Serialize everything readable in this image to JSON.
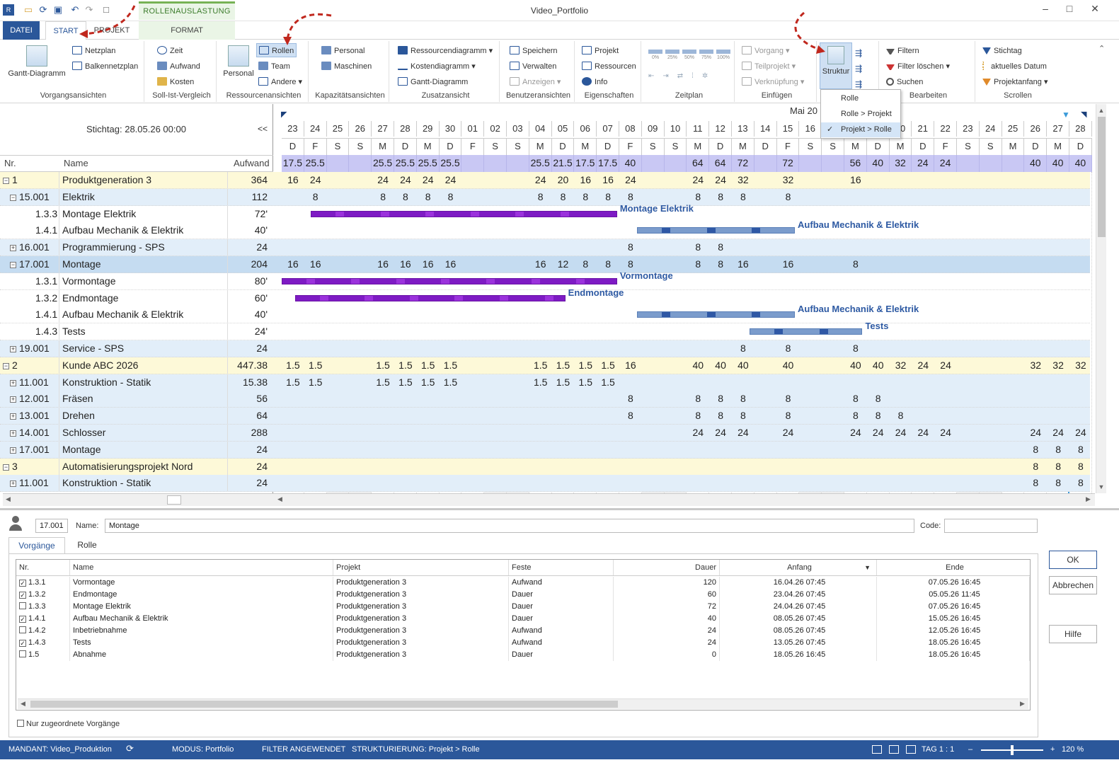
{
  "window": {
    "title": "Video_Portfolio",
    "context_tab": "ROLLENAUSLASTUNG"
  },
  "tabs": [
    "DATEI",
    "START",
    "PROJEKT",
    "FORMAT"
  ],
  "ribbon": {
    "vorgangsansichten": {
      "label": "Vorgangsansichten",
      "gantt": "Gantt-Diagramm",
      "netzplan": "Netzplan",
      "balkennetzplan": "Balkennetzplan"
    },
    "sollist": {
      "label": "Soll-Ist-Vergleich",
      "zeit": "Zeit",
      "aufwand": "Aufwand",
      "kosten": "Kosten"
    },
    "ressourcen": {
      "label": "Ressourcenansichten",
      "personal": "Personal",
      "rollen": "Rollen",
      "team": "Team",
      "andere": "Andere"
    },
    "kapazitaet": {
      "label": "Kapazitätsansichten",
      "personal": "Personal",
      "maschinen": "Maschinen"
    },
    "zusatz": {
      "label": "Zusatzansicht",
      "ressourcendiagramm": "Ressourcendiagramm",
      "kostendiagramm": "Kostendiagramm",
      "gantt": "Gantt-Diagramm"
    },
    "benutzer": {
      "label": "Benutzeransichten",
      "speichern": "Speichern",
      "verwalten": "Verwalten",
      "anzeigen": "Anzeigen"
    },
    "eigenschaften": {
      "label": "Eigenschaften",
      "projekt": "Projekt",
      "ressourcen": "Ressourcen",
      "info": "Info"
    },
    "zeitplan": {
      "label": "Zeitplan",
      "pct": [
        "0%",
        "25%",
        "50%",
        "75%",
        "100%"
      ]
    },
    "einfuegen": {
      "label": "Einfügen",
      "vorgang": "Vorgang",
      "teilprojekt": "Teilprojekt",
      "verknuepfung": "Verknüpfung"
    },
    "struktur": {
      "label": "Struktur"
    },
    "bearbeiten": {
      "label": "Bearbeiten",
      "filtern": "Filtern",
      "filter_loeschen": "Filter löschen",
      "suchen": "Suchen"
    },
    "scrollen": {
      "label": "Scrollen",
      "stichtag": "Stichtag",
      "aktuelles_datum": "aktuelles Datum",
      "projektanfang": "Projektanfang"
    }
  },
  "struktur_menu": {
    "items": [
      "Rolle",
      "Rolle > Projekt",
      "Projekt > Rolle"
    ],
    "checked": "Projekt > Rolle"
  },
  "grid": {
    "stichtag": "Stichtag: 28.05.26 00:00",
    "collapse": "<<",
    "headers": {
      "nr": "Nr.",
      "name": "Name",
      "aufwand": "Aufwand"
    },
    "month": "Mai 20",
    "days": [
      "23",
      "24",
      "25",
      "26",
      "27",
      "28",
      "29",
      "30",
      "01",
      "02",
      "03",
      "04",
      "05",
      "06",
      "07",
      "08",
      "09",
      "10",
      "11",
      "12",
      "13",
      "14",
      "15",
      "16",
      "17",
      "18",
      "19",
      "20",
      "21",
      "22",
      "23",
      "24",
      "25",
      "26",
      "27",
      "28"
    ],
    "weekdays": [
      "D",
      "F",
      "S",
      "S",
      "M",
      "D",
      "M",
      "D",
      "F",
      "S",
      "S",
      "M",
      "D",
      "M",
      "D",
      "F",
      "S",
      "S",
      "M",
      "D",
      "M",
      "D",
      "F",
      "S",
      "S",
      "M",
      "D",
      "M",
      "D",
      "F",
      "S",
      "S",
      "M",
      "D",
      "M",
      "D"
    ],
    "totals": [
      "17.5",
      "25.5",
      "",
      "",
      "25.5",
      "25.5",
      "25.5",
      "25.5",
      "",
      "",
      "",
      "25.5",
      "21.5",
      "17.5",
      "17.5",
      "40",
      "",
      "",
      "64",
      "64",
      "72",
      "",
      "72",
      "",
      "",
      "56",
      "40",
      "32",
      "24",
      "24",
      "",
      "",
      "",
      "40",
      "40",
      "40"
    ],
    "rows": [
      {
        "nr": "1",
        "name": "Produktgeneration 3",
        "aufwand": "364",
        "exp": "−",
        "level": 0,
        "type": "proj",
        "vals": [
          "16",
          "24",
          "",
          "",
          "24",
          "24",
          "24",
          "24",
          "",
          "",
          "",
          "24",
          "20",
          "16",
          "16",
          "24",
          "",
          "",
          "24",
          "24",
          "32",
          "",
          "32",
          "",
          "",
          "16",
          "",
          "",
          "",
          "",
          "",
          "",
          "",
          "",
          "",
          ""
        ]
      },
      {
        "nr": "15.001",
        "name": "Elektrik",
        "aufwand": "112",
        "exp": "−",
        "level": 1,
        "type": "role",
        "vals": [
          "",
          "8",
          "",
          "",
          "8",
          "8",
          "8",
          "8",
          "",
          "",
          "",
          "8",
          "8",
          "8",
          "8",
          "8",
          "",
          "",
          "8",
          "8",
          "8",
          "",
          "8",
          "",
          "",
          "",
          "",
          "",
          "",
          "",
          "",
          "",
          "",
          "",
          "",
          ""
        ]
      },
      {
        "nr": "1.3.3",
        "name": "Montage Elektrik",
        "aufwand": "72'",
        "level": 2,
        "type": "task",
        "vals": []
      },
      {
        "nr": "1.4.1",
        "name": "Aufbau Mechanik & Elektrik",
        "aufwand": "40'",
        "level": 2,
        "type": "task",
        "vals": []
      },
      {
        "nr": "16.001",
        "name": "Programmierung - SPS",
        "aufwand": "24",
        "exp": "+",
        "level": 1,
        "type": "role",
        "vals": [
          "",
          "",
          "",
          "",
          "",
          "",
          "",
          "",
          "",
          "",
          "",
          "",
          "",
          "",
          "",
          "8",
          "",
          "",
          "8",
          "8",
          "",
          "",
          "",
          "",
          "",
          "",
          "",
          "",
          "",
          "",
          "",
          "",
          "",
          "",
          "",
          ""
        ]
      },
      {
        "nr": "17.001",
        "name": "Montage",
        "aufwand": "204",
        "exp": "−",
        "level": 1,
        "type": "rolesel",
        "vals": [
          "16",
          "16",
          "",
          "",
          "16",
          "16",
          "16",
          "16",
          "",
          "",
          "",
          "16",
          "12",
          "8",
          "8",
          "8",
          "",
          "",
          "8",
          "8",
          "16",
          "",
          "16",
          "",
          "",
          "8",
          "",
          "",
          "",
          "",
          "",
          "",
          "",
          "",
          "",
          ""
        ]
      },
      {
        "nr": "1.3.1",
        "name": "Vormontage",
        "aufwand": "80'",
        "level": 2,
        "type": "task",
        "vals": []
      },
      {
        "nr": "1.3.2",
        "name": "Endmontage",
        "aufwand": "60'",
        "level": 2,
        "type": "task",
        "vals": []
      },
      {
        "nr": "1.4.1",
        "name": "Aufbau Mechanik & Elektrik",
        "aufwand": "40'",
        "level": 2,
        "type": "task",
        "vals": []
      },
      {
        "nr": "1.4.3",
        "name": "Tests",
        "aufwand": "24'",
        "level": 2,
        "type": "task",
        "vals": []
      },
      {
        "nr": "19.001",
        "name": "Service - SPS",
        "aufwand": "24",
        "exp": "+",
        "level": 1,
        "type": "role",
        "vals": [
          "",
          "",
          "",
          "",
          "",
          "",
          "",
          "",
          "",
          "",
          "",
          "",
          "",
          "",
          "",
          "",
          "",
          "",
          "",
          "",
          "8",
          "",
          "8",
          "",
          "",
          "8",
          "",
          "",
          "",
          "",
          "",
          "",
          "",
          "",
          "",
          ""
        ]
      },
      {
        "nr": "2",
        "name": "Kunde ABC 2026",
        "aufwand": "447.38",
        "exp": "−",
        "level": 0,
        "type": "proj",
        "vals": [
          "1.5",
          "1.5",
          "",
          "",
          "1.5",
          "1.5",
          "1.5",
          "1.5",
          "",
          "",
          "",
          "1.5",
          "1.5",
          "1.5",
          "1.5",
          "16",
          "",
          "",
          "40",
          "40",
          "40",
          "",
          "40",
          "",
          "",
          "40",
          "40",
          "32",
          "24",
          "24",
          "",
          "",
          "",
          "32",
          "32",
          "32"
        ]
      },
      {
        "nr": "11.001",
        "name": "Konstruktion - Statik",
        "aufwand": "15.38",
        "exp": "+",
        "level": 1,
        "type": "role",
        "vals": [
          "1.5",
          "1.5",
          "",
          "",
          "1.5",
          "1.5",
          "1.5",
          "1.5",
          "",
          "",
          "",
          "1.5",
          "1.5",
          "1.5",
          "1.5",
          "",
          "",
          "",
          "",
          "",
          "",
          "",
          "",
          "",
          "",
          "",
          "",
          "",
          "",
          "",
          "",
          "",
          "",
          "",
          "",
          ""
        ]
      },
      {
        "nr": "12.001",
        "name": "Fräsen",
        "aufwand": "56",
        "exp": "+",
        "level": 1,
        "type": "role",
        "vals": [
          "",
          "",
          "",
          "",
          "",
          "",
          "",
          "",
          "",
          "",
          "",
          "",
          "",
          "",
          "",
          "8",
          "",
          "",
          "8",
          "8",
          "8",
          "",
          "8",
          "",
          "",
          "8",
          "8",
          "",
          "",
          "",
          "",
          "",
          "",
          "",
          "",
          ""
        ]
      },
      {
        "nr": "13.001",
        "name": "Drehen",
        "aufwand": "64",
        "exp": "+",
        "level": 1,
        "type": "role",
        "vals": [
          "",
          "",
          "",
          "",
          "",
          "",
          "",
          "",
          "",
          "",
          "",
          "",
          "",
          "",
          "",
          "8",
          "",
          "",
          "8",
          "8",
          "8",
          "",
          "8",
          "",
          "",
          "8",
          "8",
          "8",
          "",
          "",
          "",
          "",
          "",
          "",
          "",
          ""
        ]
      },
      {
        "nr": "14.001",
        "name": "Schlosser",
        "aufwand": "288",
        "exp": "+",
        "level": 1,
        "type": "role",
        "vals": [
          "",
          "",
          "",
          "",
          "",
          "",
          "",
          "",
          "",
          "",
          "",
          "",
          "",
          "",
          "",
          "",
          "",
          "",
          "24",
          "24",
          "24",
          "",
          "24",
          "",
          "",
          "24",
          "24",
          "24",
          "24",
          "24",
          "",
          "",
          "",
          "24",
          "24",
          "24"
        ]
      },
      {
        "nr": "17.001",
        "name": "Montage",
        "aufwand": "24",
        "exp": "+",
        "level": 1,
        "type": "role",
        "vals": [
          "",
          "",
          "",
          "",
          "",
          "",
          "",
          "",
          "",
          "",
          "",
          "",
          "",
          "",
          "",
          "",
          "",
          "",
          "",
          "",
          "",
          "",
          "",
          "",
          "",
          "",
          "",
          "",
          "",
          "",
          "",
          "",
          "",
          "8",
          "8",
          "8"
        ]
      },
      {
        "nr": "3",
        "name": "Automatisierungsprojekt Nord",
        "aufwand": "24",
        "exp": "−",
        "level": 0,
        "type": "proj",
        "vals": [
          "",
          "",
          "",
          "",
          "",
          "",
          "",
          "",
          "",
          "",
          "",
          "",
          "",
          "",
          "",
          "",
          "",
          "",
          "",
          "",
          "",
          "",
          "",
          "",
          "",
          "",
          "",
          "",
          "",
          "",
          "",
          "",
          "",
          "8",
          "8",
          "8"
        ]
      },
      {
        "nr": "11.001",
        "name": "Konstruktion - Statik",
        "aufwand": "24",
        "exp": "+",
        "level": 1,
        "type": "role",
        "vals": [
          "",
          "",
          "",
          "",
          "",
          "",
          "",
          "",
          "",
          "",
          "",
          "",
          "",
          "",
          "",
          "",
          "",
          "",
          "",
          "",
          "",
          "",
          "",
          "",
          "",
          "",
          "",
          "",
          "",
          "",
          "",
          "",
          "",
          "8",
          "8",
          "8"
        ]
      }
    ],
    "bars": [
      {
        "label": "Montage Elektrik",
        "row": 2,
        "start": 1.3,
        "end": 14.9,
        "color": "purple"
      },
      {
        "label": "Aufbau Mechanik & Elektrik",
        "row": 3,
        "start": 15.8,
        "end": 22.8,
        "color": "blue"
      },
      {
        "label": "Vormontage",
        "row": 6,
        "start": 0,
        "end": 14.9,
        "color": "purple"
      },
      {
        "label": "Endmontage",
        "row": 7,
        "start": 0.6,
        "end": 12.6,
        "color": "purple"
      },
      {
        "label": "Aufbau Mechanik & Elektrik",
        "row": 8,
        "start": 15.8,
        "end": 22.8,
        "color": "blue"
      },
      {
        "label": "Tests",
        "row": 9,
        "start": 20.8,
        "end": 25.8,
        "color": "blue"
      }
    ]
  },
  "detail": {
    "nr": "17.001",
    "name_label": "Name:",
    "name": "Montage",
    "code_label": "Code:",
    "code": "",
    "tabs": [
      "Vorgänge",
      "Rolle"
    ],
    "columns": [
      "Nr.",
      "Name",
      "Projekt",
      "Feste",
      "Dauer",
      "Anfang",
      "Ende"
    ],
    "rows": [
      {
        "checked": true,
        "nr": "1.3.1",
        "name": "Vormontage",
        "projekt": "Produktgeneration 3",
        "feste": "Aufwand",
        "dauer": "120",
        "anfang": "16.04.26 07:45",
        "ende": "07.05.26 16:45"
      },
      {
        "checked": true,
        "nr": "1.3.2",
        "name": "Endmontage",
        "projekt": "Produktgeneration 3",
        "feste": "Dauer",
        "dauer": "60",
        "anfang": "23.04.26 07:45",
        "ende": "05.05.26 11:45"
      },
      {
        "checked": false,
        "nr": "1.3.3",
        "name": "Montage Elektrik",
        "projekt": "Produktgeneration 3",
        "feste": "Dauer",
        "dauer": "72",
        "anfang": "24.04.26 07:45",
        "ende": "07.05.26 16:45"
      },
      {
        "checked": true,
        "nr": "1.4.1",
        "name": "Aufbau Mechanik & Elektrik",
        "projekt": "Produktgeneration 3",
        "feste": "Dauer",
        "dauer": "40",
        "anfang": "08.05.26 07:45",
        "ende": "15.05.26 16:45"
      },
      {
        "checked": false,
        "nr": "1.4.2",
        "name": "Inbetriebnahme",
        "projekt": "Produktgeneration 3",
        "feste": "Aufwand",
        "dauer": "24",
        "anfang": "08.05.26 07:45",
        "ende": "12.05.26 16:45"
      },
      {
        "checked": true,
        "nr": "1.4.3",
        "name": "Tests",
        "projekt": "Produktgeneration 3",
        "feste": "Aufwand",
        "dauer": "24",
        "anfang": "13.05.26 07:45",
        "ende": "18.05.26 16:45"
      },
      {
        "checked": false,
        "nr": "1.5",
        "name": "Abnahme",
        "projekt": "Produktgeneration 3",
        "feste": "Dauer",
        "dauer": "0",
        "anfang": "18.05.26 16:45",
        "ende": "18.05.26 16:45"
      }
    ],
    "only_assigned": "Nur zugeordnete Vorgänge",
    "ok": "OK",
    "cancel": "Abbrechen",
    "help": "Hilfe"
  },
  "status": {
    "mandant": "MANDANT: Video_Produktion",
    "modus": "MODUS: Portfolio",
    "filter": "FILTER ANGEWENDET",
    "strukt": "STRUKTURIERUNG: Projekt > Rolle",
    "tag": "TAG 1 : 1",
    "zoom": "120 %"
  },
  "colors": {
    "accent": "#2b579a",
    "project_row": "#fdf9d8",
    "role_row": "#e2eef9",
    "role_selected": "#c5dcf1",
    "bar_purple": "#7e1bc4",
    "bar_blue": "#7b9ccc"
  }
}
